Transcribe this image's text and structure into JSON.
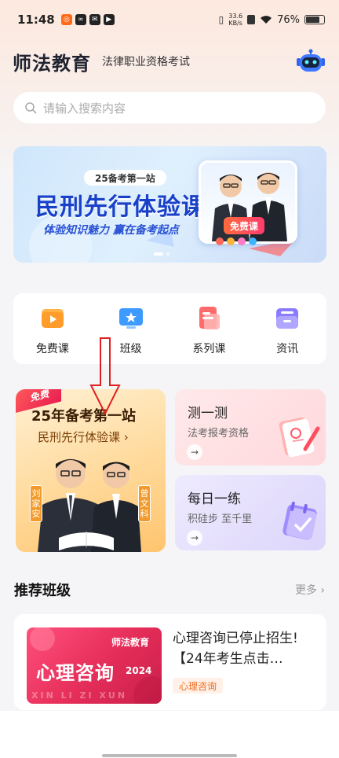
{
  "status_bar": {
    "time": "11:48",
    "net_speed_value": "33.6",
    "net_speed_unit": "KB/s",
    "battery": "76%",
    "battery_level": 0.76
  },
  "header": {
    "brand": "师法教育",
    "subtitle": "法律职业资格考试",
    "assistant_icon": "robot-icon"
  },
  "search": {
    "placeholder": "请输入搜索内容",
    "icon": "search-icon"
  },
  "banner": {
    "tag": "25备考第一站",
    "title": "民刑先行体验课",
    "subtitle": "体验知识魅力 赢在备考起点",
    "free_label": "免费课",
    "active_slide": 1,
    "slide_count": 2
  },
  "categories": [
    {
      "label": "免费课",
      "icon": "play-icon",
      "color": "#ff9c2a"
    },
    {
      "label": "班级",
      "icon": "monitor-star-icon",
      "color": "#3d9bff"
    },
    {
      "label": "系列课",
      "icon": "document-icon",
      "color": "#ff5a5a"
    },
    {
      "label": "资讯",
      "icon": "inbox-icon",
      "color": "#8a7bff"
    }
  ],
  "promo": {
    "free_tag": "免费",
    "title": "25年备考第一站",
    "subtitle": "民刑先行体验课 ›",
    "teacher_left": "刘家安",
    "teacher_right": "曾文科"
  },
  "quiz_card": {
    "title": "测一测",
    "subtitle": "法考报考资格",
    "arrow": "→"
  },
  "daily_card": {
    "title": "每日一练",
    "subtitle": "积硅步 至千里",
    "arrow": "→"
  },
  "recommend": {
    "title": "推荐班级",
    "more": "更多 ›"
  },
  "course": {
    "thumb_brand": "师法教育",
    "thumb_title": "心理咨询",
    "thumb_year": "2024",
    "thumb_pinyin": "XIN LI ZI XUN",
    "title": "心理咨询已停止招生!【24年考生点击…",
    "tag": "心理咨询"
  },
  "colors": {
    "brand_blue": "#1940c9",
    "accent_orange": "#f26a1b",
    "annotation_red": "#e02020"
  }
}
